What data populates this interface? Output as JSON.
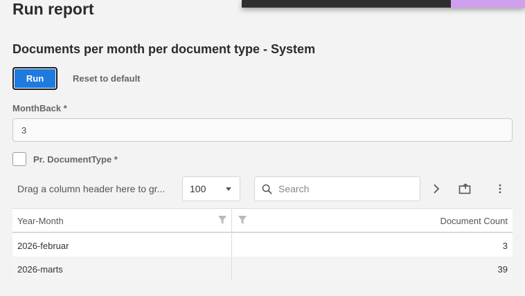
{
  "page": {
    "title": "Run report"
  },
  "report": {
    "title": "Documents per month per document type - System"
  },
  "actions": {
    "run_label": "Run",
    "reset_label": "Reset to default"
  },
  "params": {
    "monthback": {
      "label": "MonthBack *",
      "value": "3"
    },
    "doctype": {
      "label": "Pr. DocumentType *",
      "checked": false
    }
  },
  "toolbar": {
    "group_panel_text": "Drag a column header here to gr...",
    "page_size": "100",
    "search_placeholder": "Search",
    "icons": [
      "chevron-right-icon",
      "export-icon",
      "more-vert-icon"
    ]
  },
  "grid": {
    "columns": [
      "Year-Month",
      "Document Count"
    ],
    "rows": [
      {
        "month": "2026-februar",
        "count": "3"
      },
      {
        "month": "2026-marts",
        "count": "39"
      }
    ]
  },
  "colors": {
    "accent": "#1f7ae0",
    "topbar": "#2e2e2e",
    "topbar_accent": "#cfa0f0"
  }
}
